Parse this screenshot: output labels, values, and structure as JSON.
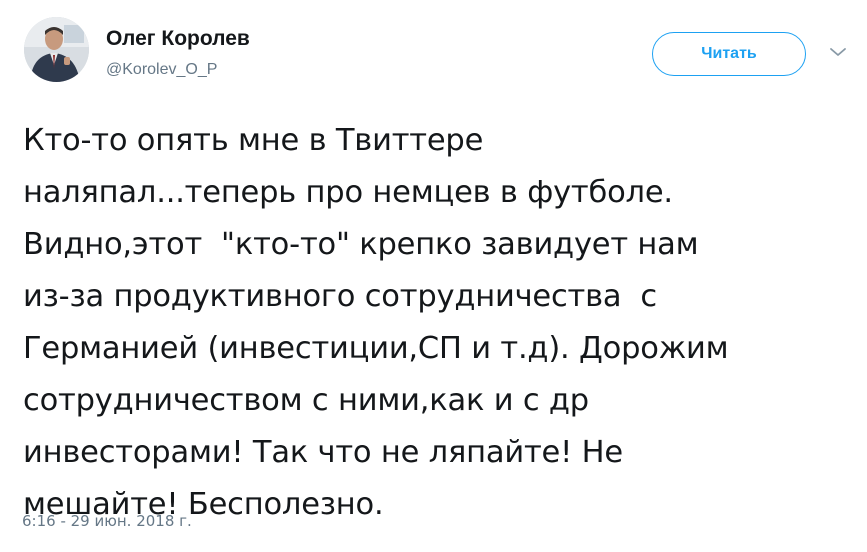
{
  "author": {
    "display_name": "Олег Королев",
    "handle": "@Korolev_O_P",
    "avatar_icon": "person-photo-icon"
  },
  "follow_button": {
    "label": "Читать",
    "color": "#1da1f2"
  },
  "menu": {
    "icon": "chevron-down-icon"
  },
  "tweet": {
    "lines": [
      "Кто-то опять мне в Твиттере",
      "наляпал...теперь про немцев в футболе.",
      "Видно,этот  \"кто-то\" крепко завидует нам",
      "из-за продуктивного сотрудничества  с",
      "Германией (инвестиции,СП и т.д). Дорожим",
      "сотрудничеством с ними,как и с др",
      "инвесторами! Так что не ляпайте! Не",
      "мешайте! Бесполезно."
    ],
    "timestamp": "6:16 - 29 июн. 2018 г."
  }
}
